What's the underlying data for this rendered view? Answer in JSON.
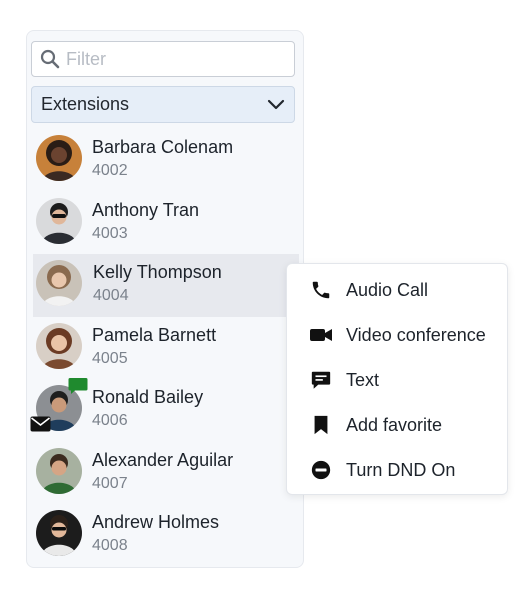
{
  "filter": {
    "placeholder": "Filter",
    "value": ""
  },
  "dropdown": {
    "selected": "Extensions"
  },
  "contacts": [
    {
      "name": "Barbara Colenam",
      "ext": "4002"
    },
    {
      "name": "Anthony Tran",
      "ext": "4003"
    },
    {
      "name": "Kelly Thompson",
      "ext": "4004"
    },
    {
      "name": "Pamela Barnett",
      "ext": "4005"
    },
    {
      "name": "Ronald Bailey",
      "ext": "4006"
    },
    {
      "name": "Alexander Aguilar",
      "ext": "4007"
    },
    {
      "name": "Andrew Holmes",
      "ext": "4008"
    }
  ],
  "menu": {
    "items": [
      {
        "label": "Audio Call",
        "icon": "phone-icon"
      },
      {
        "label": "Video conference",
        "icon": "video-camera-icon"
      },
      {
        "label": "Text",
        "icon": "message-icon"
      },
      {
        "label": "Add favorite",
        "icon": "bookmark-icon"
      },
      {
        "label": "Turn DND On",
        "icon": "do-not-disturb-icon"
      }
    ]
  },
  "colors": {
    "panel_bg": "#f6f8fb",
    "dropdown_bg": "#e6eef8",
    "selected_row_bg": "#e7e9ee",
    "presence_green": "#1f8a2e"
  }
}
